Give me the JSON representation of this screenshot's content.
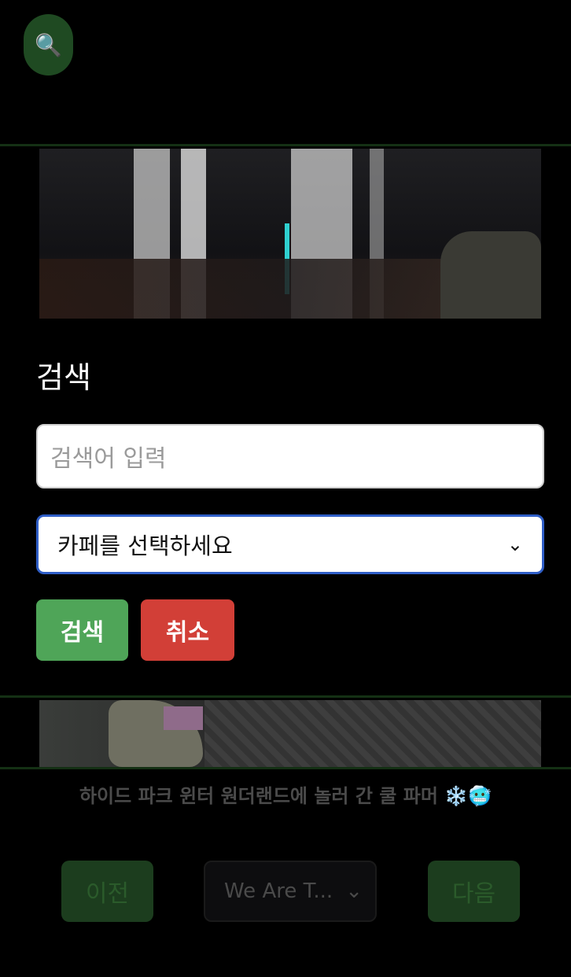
{
  "fab": {
    "icon": "search-icon",
    "glyph": "🔍"
  },
  "panel": {
    "title": "검색",
    "search_placeholder": "검색어 입력",
    "select_value": "카페를 선택하세요",
    "search_button": "검색",
    "cancel_button": "취소"
  },
  "caption": "하이드 파크 윈터 원더랜드에 놀러 간 쿨 파머 ❄️🥶",
  "nav": {
    "prev": "이전",
    "playlist_value": "We Are T...",
    "next": "다음"
  }
}
